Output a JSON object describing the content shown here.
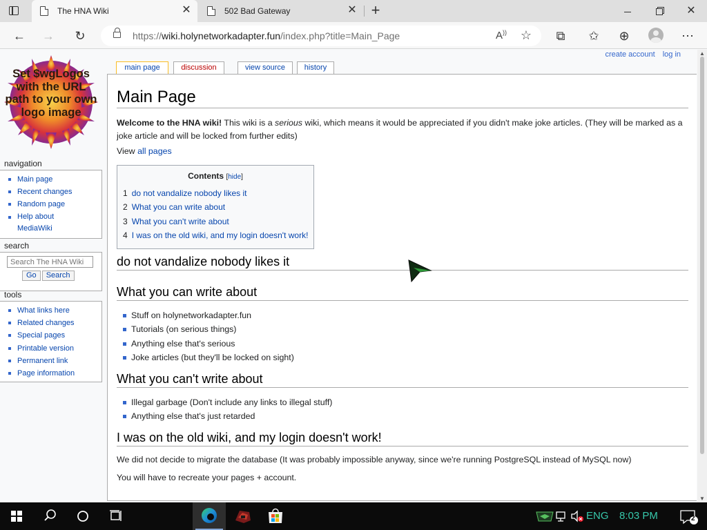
{
  "browser": {
    "tabs": [
      {
        "title": "The HNA Wiki",
        "active": true
      },
      {
        "title": "502 Bad Gateway",
        "active": false
      }
    ],
    "address": {
      "scheme": "https://",
      "host": "wiki.holynetworkadapter.fun",
      "path": "/index.php?title=Main_Page"
    },
    "icons": {
      "back": "back-arrow-icon",
      "forward": "forward-arrow-icon",
      "refresh": "refresh-icon",
      "read_aloud": "read-aloud-icon",
      "add_favorite": "add-favorite-icon",
      "extensions": "extensions-icon",
      "favorites": "favorites-icon",
      "collections": "collections-icon",
      "profile": "profile-icon",
      "menu": "more-menu-icon"
    }
  },
  "wiki": {
    "personal_tools": {
      "create_account": "create account",
      "log_in": "log in"
    },
    "logo_text": "Set $wgLogos with the URL path to your own logo image",
    "navigation": {
      "heading": "navigation",
      "items": [
        "Main page",
        "Recent changes",
        "Random page",
        "Help about MediaWiki"
      ]
    },
    "search": {
      "heading": "search",
      "placeholder": "Search The HNA Wiki",
      "go_label": "Go",
      "search_label": "Search"
    },
    "tools": {
      "heading": "tools",
      "items": [
        "What links here",
        "Related changes",
        "Special pages",
        "Printable version",
        "Permanent link",
        "Page information"
      ]
    },
    "content_tabs": {
      "main_page": "main page",
      "discussion": "discussion",
      "view_source": "view source",
      "history": "history"
    },
    "page": {
      "title": "Main Page",
      "intro_bold": "Welcome to the HNA wiki!",
      "intro_a": " This wiki is a ",
      "intro_italic": "serious",
      "intro_b": " wiki, which means it would be appreciated if you didn't make joke articles. (They will be marked as a joke article and will be locked from further edits)",
      "view_prefix": "View ",
      "view_link": "all pages",
      "toc": {
        "title": "Contents",
        "hide_open": "[",
        "hide_label": "hide",
        "hide_close": "]",
        "items": [
          {
            "num": "1",
            "text": "do not vandalize nobody likes it"
          },
          {
            "num": "2",
            "text": "What you can write about"
          },
          {
            "num": "3",
            "text": "What you can't write about"
          },
          {
            "num": "4",
            "text": "I was on the old wiki, and my login doesn't work!"
          }
        ]
      },
      "sections": [
        {
          "heading": "do not vandalize nobody likes it"
        },
        {
          "heading": "What you can write about",
          "items": [
            "Stuff on holynetworkadapter.fun",
            "Tutorials (on serious things)",
            "Anything else that's serious",
            "Joke articles (but they'll be locked on sight)"
          ]
        },
        {
          "heading": "What you can't write about",
          "items": [
            "Illegal garbage (Don't include any links to illegal stuff)",
            "Anything else that's just retarded"
          ]
        },
        {
          "heading": "I was on the old wiki, and my login doesn't work!",
          "paragraphs": [
            "We did not decide to migrate the database (It was probably impossible anyway, since we're running PostgreSQL instead of MySQL now)",
            "You will have to recreate your pages + account."
          ]
        }
      ]
    }
  },
  "taskbar": {
    "language": "ENG",
    "time": "8:03 PM",
    "notifications": "2"
  }
}
